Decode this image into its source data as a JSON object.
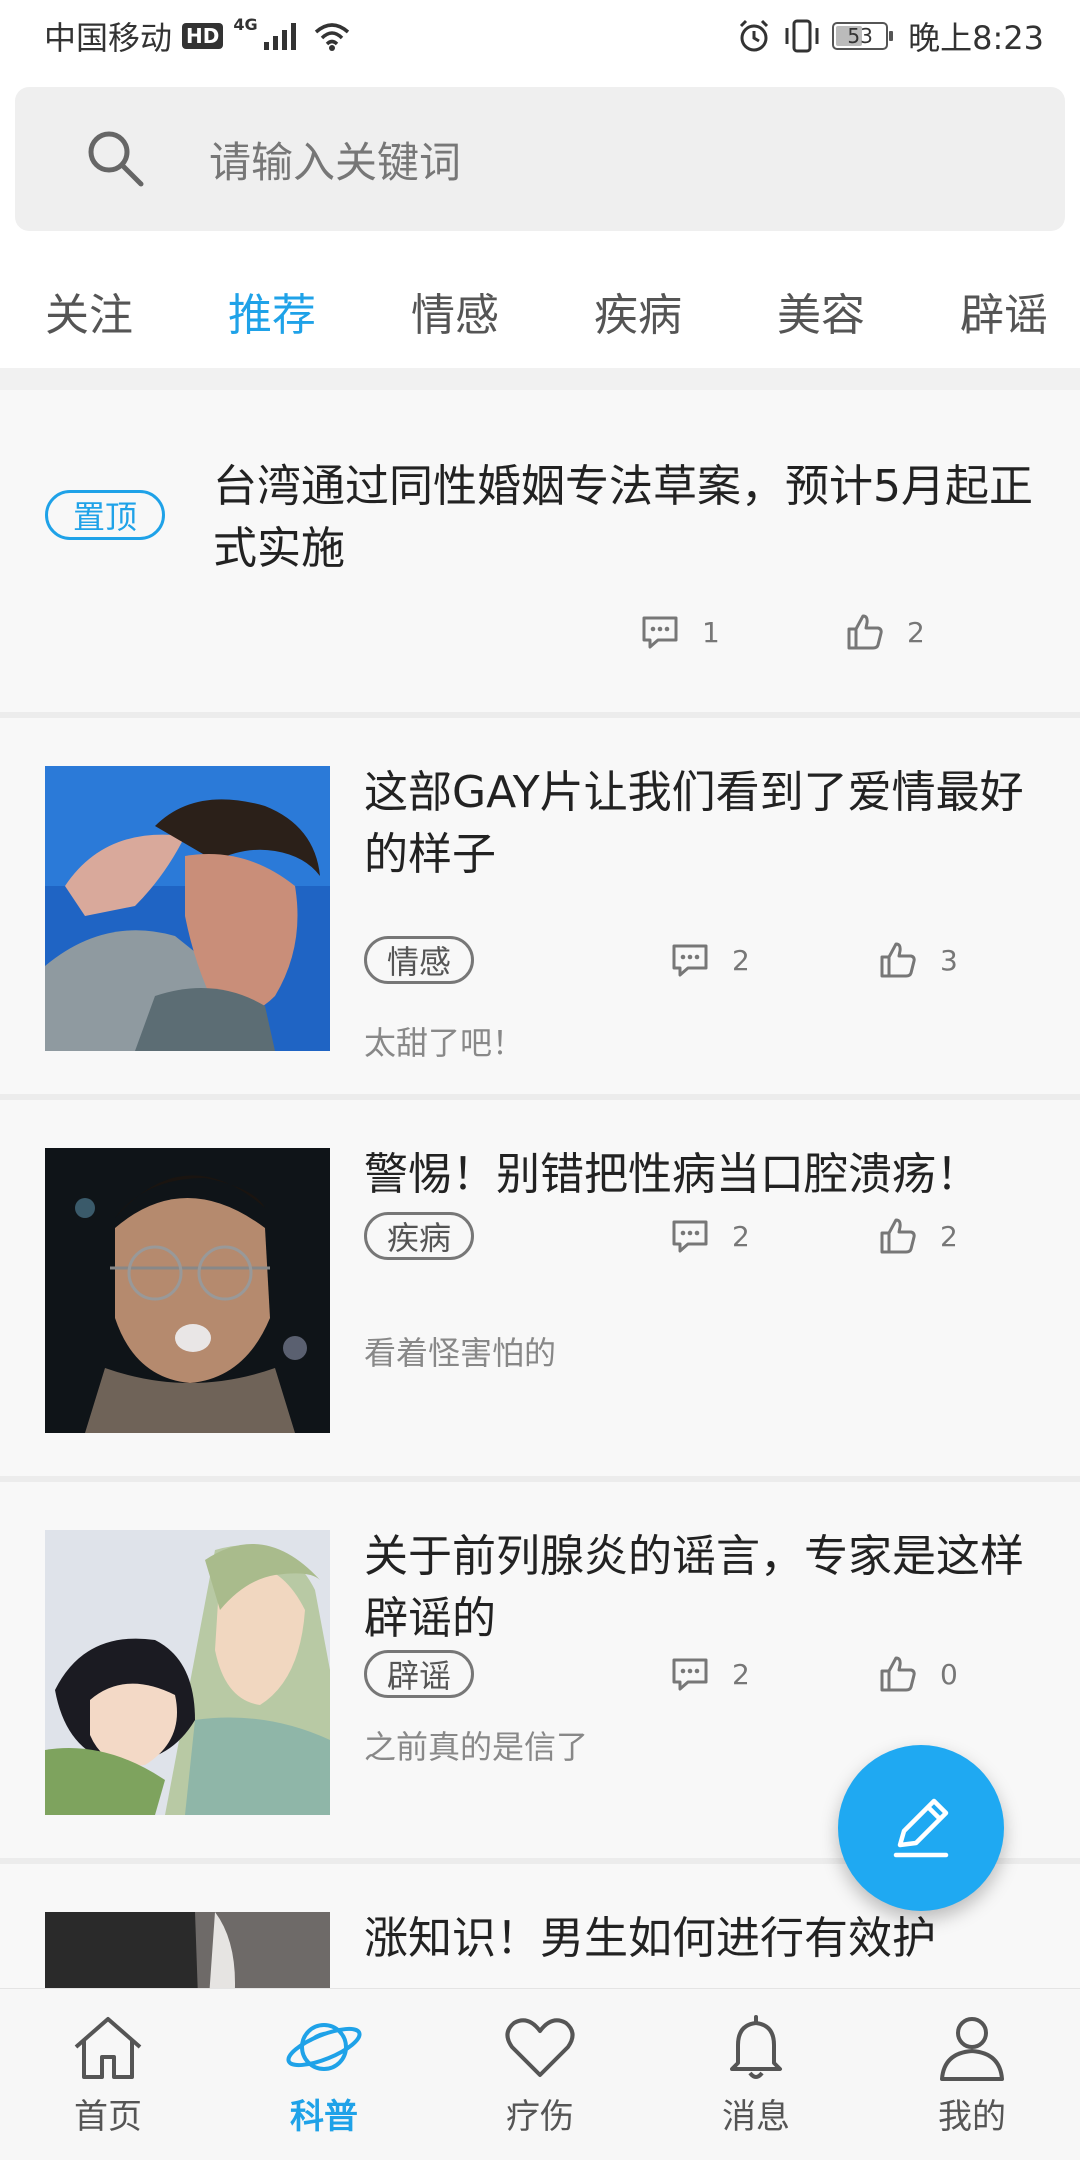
{
  "status": {
    "carrier": "中国移动",
    "hd": "HD",
    "net": "4G",
    "battery": "53",
    "time": "晚上8:23"
  },
  "search": {
    "placeholder": "请输入关键词"
  },
  "tabs": [
    {
      "label": "关注"
    },
    {
      "label": "推荐"
    },
    {
      "label": "情感"
    },
    {
      "label": "疾病"
    },
    {
      "label": "美容"
    },
    {
      "label": "辟谣"
    }
  ],
  "feed": {
    "pinned": {
      "badge": "置顶",
      "title": "台湾通过同性婚姻专法草案，预计5月起正式实施",
      "comments": "1",
      "likes": "2"
    },
    "posts": [
      {
        "title": "这部GAY片让我们看到了爱情最好的样子",
        "tag": "情感",
        "comments": "2",
        "likes": "3",
        "subtitle": "太甜了吧！"
      },
      {
        "title": "警惕！别错把性病当口腔溃疡！",
        "tag": "疾病",
        "comments": "2",
        "likes": "2",
        "subtitle": "看着怪害怕的"
      },
      {
        "title": "关于前列腺炎的谣言，专家是这样辟谣的",
        "tag": "辟谣",
        "comments": "2",
        "likes": "0",
        "subtitle": "之前真的是信了"
      },
      {
        "title": "涨知识！男生如何进行有效护"
      }
    ]
  },
  "bottom_nav": [
    {
      "label": "首页",
      "icon": "home-icon"
    },
    {
      "label": "科普",
      "icon": "planet-icon"
    },
    {
      "label": "疗伤",
      "icon": "heart-icon"
    },
    {
      "label": "消息",
      "icon": "bell-icon"
    },
    {
      "label": "我的",
      "icon": "user-icon"
    }
  ],
  "colors": {
    "accent": "#1fa2e8",
    "fab": "#1fa9f2"
  }
}
